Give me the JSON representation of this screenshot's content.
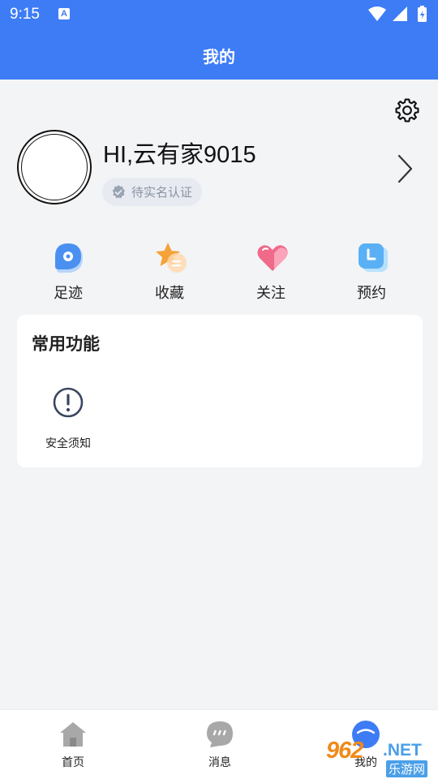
{
  "status_bar": {
    "time": "9:15",
    "notification_letter": "A"
  },
  "header": {
    "title": "我的"
  },
  "profile": {
    "greeting": "HI,云有家9015",
    "verify_label": "待实名认证"
  },
  "quick_links": [
    {
      "label": "足迹",
      "icon": "footprint-icon",
      "color": "#4a90f0"
    },
    {
      "label": "收藏",
      "icon": "star-icon",
      "color": "#f5a23a"
    },
    {
      "label": "关注",
      "icon": "heart-icon",
      "color": "#f06a8a"
    },
    {
      "label": "预约",
      "icon": "clock-icon",
      "color": "#5ab0f5"
    }
  ],
  "common_functions": {
    "title": "常用功能",
    "items": [
      {
        "label": "安全须知",
        "icon": "alert-circle-icon"
      }
    ]
  },
  "tab_bar": {
    "items": [
      {
        "label": "首页",
        "icon": "home-icon"
      },
      {
        "label": "消息",
        "icon": "message-icon"
      },
      {
        "label": "我的",
        "icon": "profile-icon"
      }
    ]
  },
  "watermark": {
    "brand": "962",
    "domain": ".NET",
    "subtitle": "乐游网"
  },
  "colors": {
    "primary": "#3d7cf5",
    "background": "#f3f4f6",
    "badge_bg": "#e7ebf1",
    "muted_text": "#8a93a3"
  }
}
